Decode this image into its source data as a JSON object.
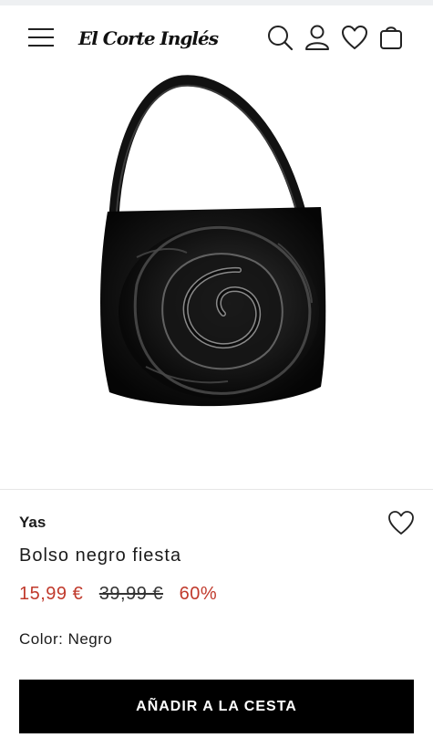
{
  "header": {
    "logo_text": "El Corte Inglés",
    "icons": [
      "menu-icon",
      "search-icon",
      "user-icon",
      "heart-icon",
      "bag-icon"
    ]
  },
  "product": {
    "brand": "Yas",
    "name": "Bolso negro fiesta",
    "price_current": "15,99 €",
    "price_original": "39,99 €",
    "discount": "60%",
    "color_line": "Color: Negro",
    "add_to_cart_label": "AÑADIR A LA CESTA"
  },
  "colors": {
    "price_accent": "#c0392b",
    "button_bg": "#000000",
    "button_text": "#ffffff"
  }
}
